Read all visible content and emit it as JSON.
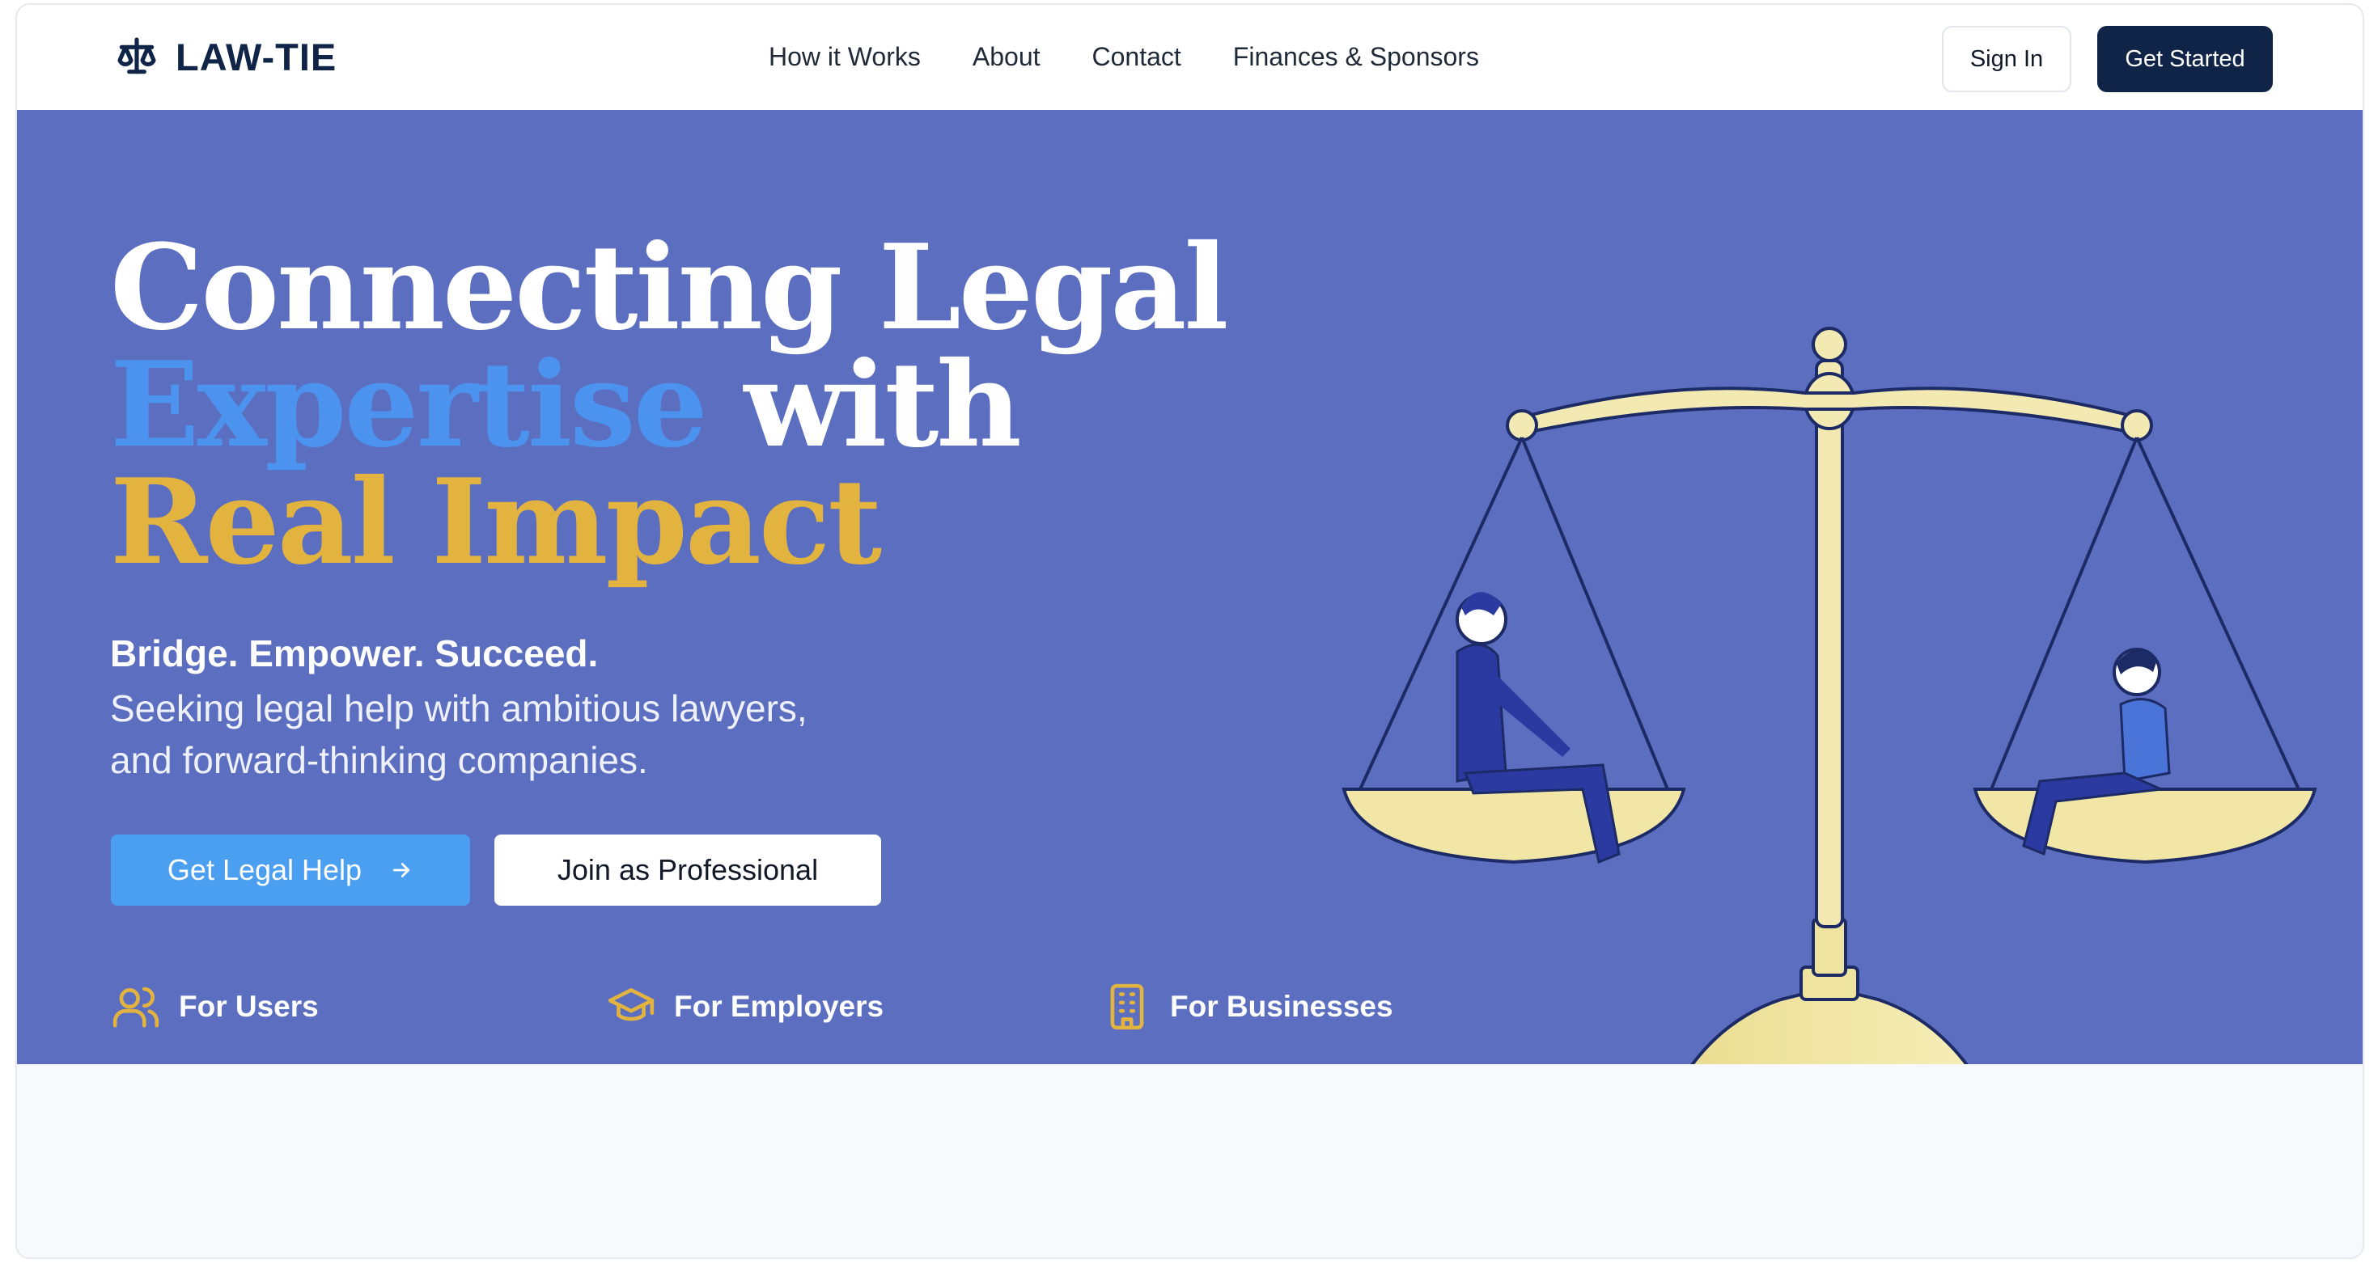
{
  "brand": {
    "name": "LAW-TIE",
    "icon": "scales-of-justice-icon"
  },
  "nav": {
    "links": [
      "How it Works",
      "About",
      "Contact",
      "Finances & Sponsors"
    ],
    "sign_in": "Sign In",
    "get_started": "Get Started"
  },
  "hero": {
    "headline": {
      "line1": "Connecting Legal",
      "line2_highlight": "Expertise",
      "line2_rest": " with",
      "line3": "Real Impact"
    },
    "tagline": "Bridge. Empower. Succeed.",
    "subtitle_line1": "Seeking legal help with ambitious lawyers,",
    "subtitle_line2": "and forward-thinking companies.",
    "primary_cta": "Get Legal Help",
    "primary_cta_icon": "arrow-right-icon",
    "secondary_cta": "Join as Professional",
    "audiences": [
      {
        "label": "For Users",
        "icon": "users-icon"
      },
      {
        "label": "For Employers",
        "icon": "graduation-cap-icon"
      },
      {
        "label": "For Businesses",
        "icon": "building-icon"
      }
    ],
    "illustration": "scales-of-justice-with-two-people"
  },
  "colors": {
    "navy": "#0f2446",
    "hero_bg": "#5c6ebf",
    "accent_blue": "#4b93ee",
    "accent_gold": "#e2b43f",
    "button_blue": "#4b9ff0"
  }
}
